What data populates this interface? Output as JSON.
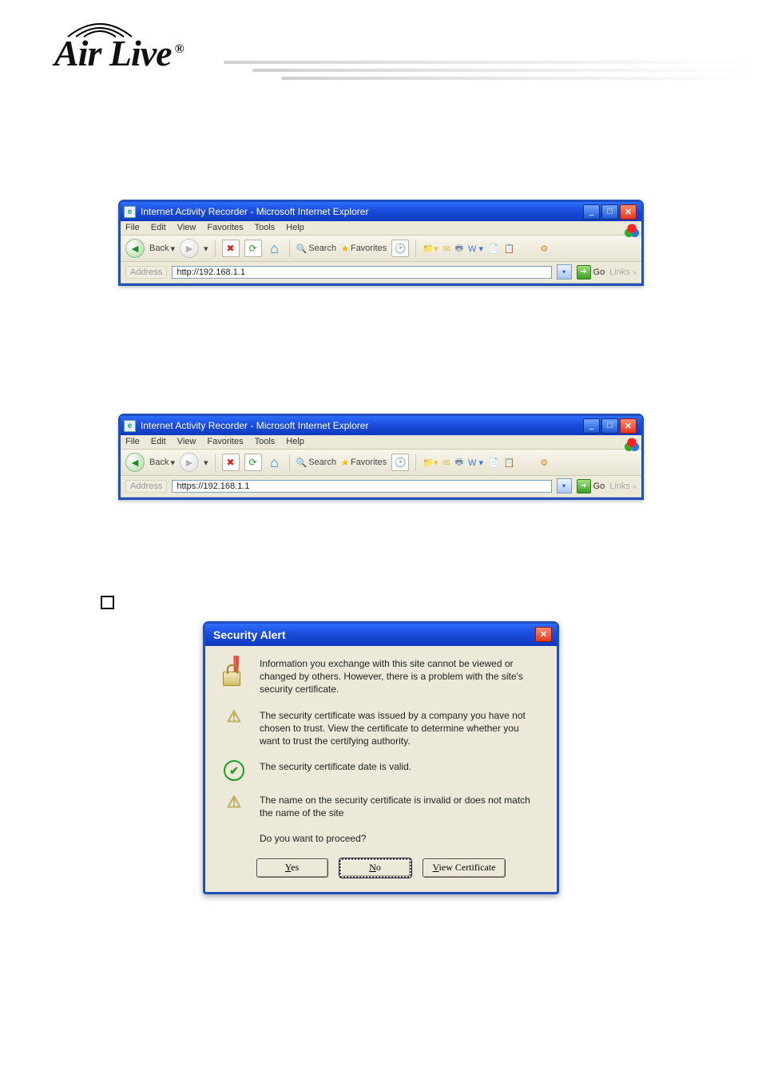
{
  "ie1": {
    "title": "Internet Activity Recorder - Microsoft Internet Explorer",
    "menus": [
      "File",
      "Edit",
      "View",
      "Favorites",
      "Tools",
      "Help"
    ],
    "toolbar": {
      "back": "Back",
      "search": "Search",
      "favorites": "Favorites"
    },
    "address": {
      "label": "Address",
      "url": "http://192.168.1.1",
      "go": "Go",
      "links": "Links"
    }
  },
  "ie2": {
    "title": "Internet Activity Recorder - Microsoft Internet Explorer",
    "menus": [
      "File",
      "Edit",
      "View",
      "Favorites",
      "Tools",
      "Help"
    ],
    "toolbar": {
      "back": "Back",
      "search": "Search",
      "favorites": "Favorites"
    },
    "address": {
      "label": "Address",
      "url": "https://192.168.1.1",
      "go": "Go",
      "links": "Links"
    }
  },
  "alert": {
    "title": "Security Alert",
    "intro": "Information you exchange with this site cannot be viewed or changed by others. However, there is a problem with the site's security certificate.",
    "item1": "The security certificate was issued by a company you have not chosen to trust. View the certificate to determine whether you want to trust the certifying authority.",
    "item2": "The security certificate date is valid.",
    "item3": "The name on the security certificate is invalid or does not match the name of the site",
    "proceed": "Do you want to proceed?",
    "yes_u": "Y",
    "yes_rest": "es",
    "no_u": "N",
    "no_rest": "o",
    "view_u": "V",
    "view_rest": "iew Certificate"
  }
}
